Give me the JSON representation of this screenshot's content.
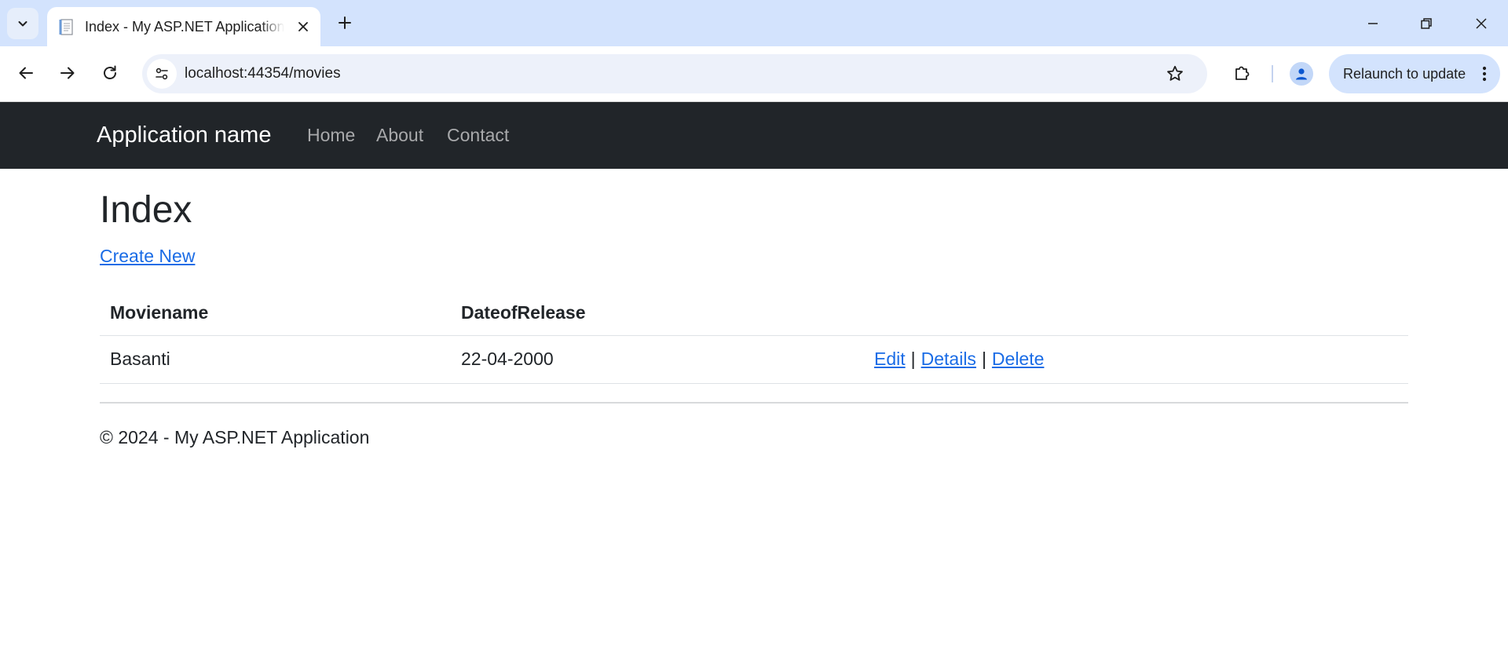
{
  "browser": {
    "tab_title": "Index - My ASP.NET Application",
    "url": "localhost:44354/movies",
    "relaunch_label": "Relaunch to update"
  },
  "navbar": {
    "brand": "Application name",
    "links": [
      "Home",
      "About",
      "Contact"
    ]
  },
  "main": {
    "title": "Index",
    "create_link": "Create New",
    "table": {
      "headers": [
        "Moviename",
        "DateofRelease"
      ],
      "rows": [
        {
          "moviename": "Basanti",
          "date_of_release": "22-04-2000",
          "actions": [
            "Edit",
            "Details",
            "Delete"
          ]
        }
      ],
      "action_separator": "|"
    }
  },
  "footer": {
    "text": "© 2024 - My ASP.NET Application"
  },
  "colors": {
    "navbar_bg": "#212529",
    "link": "#1a6ce6",
    "tabstrip_bg": "#d3e3fd"
  }
}
